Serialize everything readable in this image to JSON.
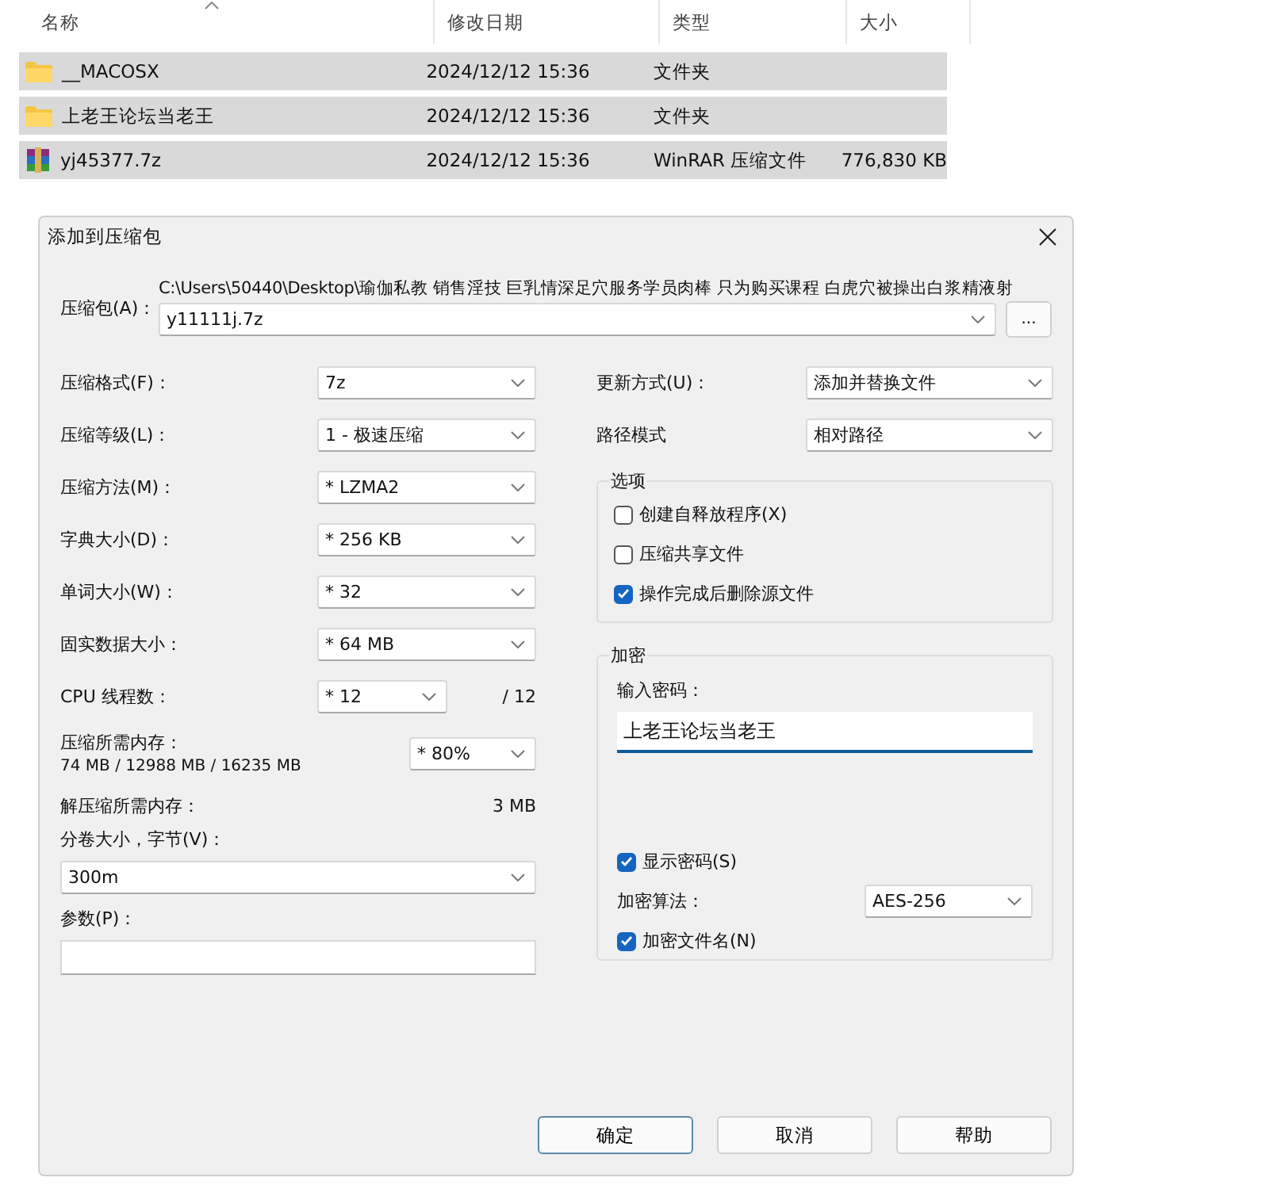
{
  "file_list": {
    "columns": [
      {
        "label": "名称",
        "sorted": true
      },
      {
        "label": "修改日期",
        "sorted": false
      },
      {
        "label": "类型",
        "sorted": false
      },
      {
        "label": "大小",
        "sorted": false
      }
    ],
    "rows": [
      {
        "kind": "folder",
        "name": "__MACOSX",
        "modified": "2024/12/12 15:36",
        "type": "文件夹",
        "selected": true
      },
      {
        "kind": "folder",
        "name": "上老王论坛当老王",
        "modified": "2024/12/12 15:36",
        "type": "文件夹",
        "selected": true
      },
      {
        "kind": "archive",
        "name": "yj45377.7z",
        "modified": "2024/12/12 15:36",
        "type": "WinRAR 压缩文件",
        "size": "776,830 KB",
        "selected": true
      }
    ]
  },
  "dialog": {
    "title": "添加到压缩包",
    "archive": {
      "label": "压缩包(A)：",
      "path": "C:\\Users\\50440\\Desktop\\瑜伽私教 销售淫技 巨乳情深足穴服务学员肉棒 只为购买课程 白虎穴被操出白浆精液射",
      "value": "y11111j.7z"
    },
    "browse_button": "...",
    "left_fields": [
      {
        "kind": "select",
        "label": "压缩格式(F)：",
        "value": "7z"
      },
      {
        "kind": "select",
        "label": "压缩等级(L)：",
        "value": "1 - 极速压缩"
      },
      {
        "kind": "select",
        "label": "压缩方法(M)：",
        "value": "* LZMA2"
      },
      {
        "kind": "select",
        "label": "字典大小(D)：",
        "value": "* 256 KB"
      },
      {
        "kind": "select",
        "label": "单词大小(W)：",
        "value": "* 32"
      },
      {
        "kind": "select",
        "label": "固实数据大小：",
        "value": "* 64 MB"
      },
      {
        "kind": "select_suffix",
        "label": "CPU 线程数：",
        "value": "* 12",
        "suffix": "/ 12"
      },
      {
        "kind": "memory",
        "label": "压缩所需内存：",
        "note": "74 MB / 12988 MB / 16235 MB",
        "value": "* 80%"
      },
      {
        "kind": "info",
        "label": "解压缩所需内存：",
        "value": "3 MB"
      },
      {
        "kind": "wide_select",
        "label": "分卷大小，字节(V)：",
        "value": "300m"
      },
      {
        "kind": "wide_input",
        "label": "参数(P)："
      }
    ],
    "right_fields": [
      {
        "label": "更新方式(U)：",
        "value": "添加并替换文件"
      },
      {
        "label": "路径模式",
        "value": "相对路径"
      }
    ],
    "options": {
      "title": "选项",
      "items": [
        {
          "label": "创建自释放程序(X)",
          "checked": false
        },
        {
          "label": "压缩共享文件",
          "checked": false
        },
        {
          "label": "操作完成后删除源文件",
          "checked": true
        }
      ]
    },
    "encryption": {
      "title": "加密",
      "password_label": "输入密码：",
      "password": "上老王论坛当老王",
      "show_password": {
        "label": "显示密码(S)",
        "checked": true
      },
      "method_label": "加密算法：",
      "method": "AES-256",
      "encrypt_names": {
        "label": "加密文件名(N)",
        "checked": true
      }
    },
    "buttons": [
      {
        "label": "确定",
        "default": true
      },
      {
        "label": "取消",
        "default": false
      },
      {
        "label": "帮助",
        "default": false
      }
    ]
  }
}
